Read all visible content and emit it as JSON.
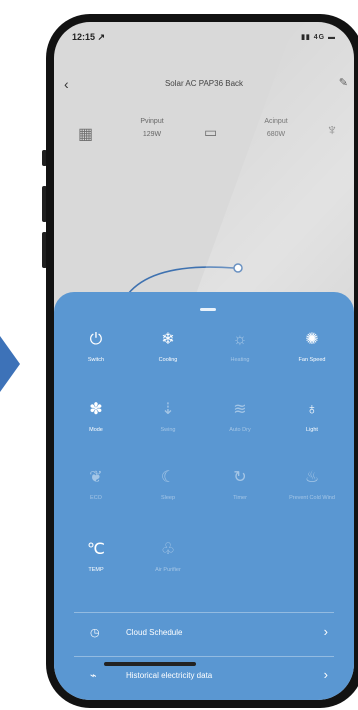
{
  "status_bar": {
    "time": "12:15 ↗",
    "signals": "▮▮ 4G ▬"
  },
  "header": {
    "back_icon": "chevron-left-icon",
    "title": "Solar AC PAP36 Back",
    "edit_icon": "pencil-icon"
  },
  "devices": {
    "pv_label": "Pvinput",
    "pv_value": "129W",
    "ac_label": "Acinput",
    "ac_value": "680W"
  },
  "controls": [
    {
      "label": "Switch",
      "icon": "power-icon",
      "active": true
    },
    {
      "label": "Cooling",
      "icon": "snowflake-icon",
      "active": true
    },
    {
      "label": "Heating",
      "icon": "sun-icon",
      "active": false
    },
    {
      "label": "Fan Speed",
      "icon": "fan-icon",
      "active": true
    },
    {
      "label": "Mode",
      "icon": "snowflake-mode-icon",
      "active": true
    },
    {
      "label": "Swing",
      "icon": "swing-icon",
      "active": false
    },
    {
      "label": "Auto Dry",
      "icon": "airflow-icon",
      "active": false
    },
    {
      "label": "Light",
      "icon": "bulb-icon",
      "active": true
    },
    {
      "label": "ECO",
      "icon": "leaf-icon",
      "active": false
    },
    {
      "label": "Sleep",
      "icon": "moon-icon",
      "active": false
    },
    {
      "label": "Timer",
      "icon": "timer-icon",
      "active": false
    },
    {
      "label": "Prevent Cold Wind",
      "icon": "wind-icon",
      "active": false
    },
    {
      "label": "TEMP",
      "icon": "thermometer-icon",
      "active": true
    },
    {
      "label": "Air Purifier",
      "icon": "purifier-icon",
      "active": false
    }
  ],
  "menu": [
    {
      "label": "Cloud Schedule",
      "icon": "clock-icon"
    },
    {
      "label": "Historical electricity data",
      "icon": "chart-icon"
    }
  ]
}
